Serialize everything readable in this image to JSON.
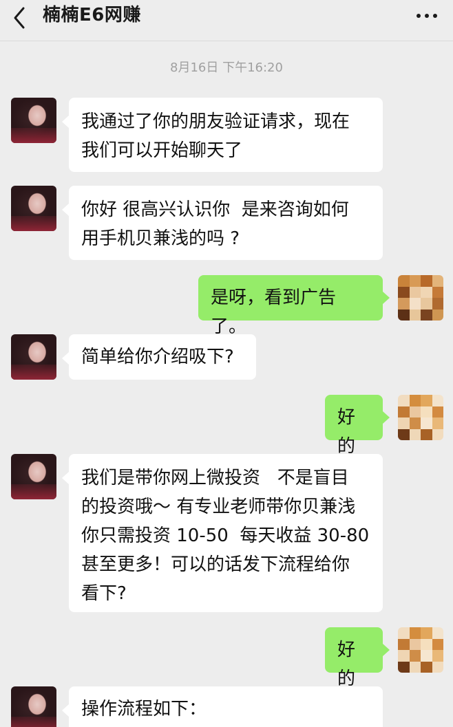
{
  "header": {
    "title": "楠楠E6网赚",
    "back_icon": "chevron-left-icon",
    "more_icon": "more-dots-icon"
  },
  "timestamp": "8月16日 下午16:20",
  "messages": [
    {
      "side": "left",
      "text": "我通过了你的朋友验证请求，现在\n我们可以开始聊天了"
    },
    {
      "side": "left",
      "text": "你好 很高兴认识你  是来咨询如何\n用手机贝兼浅的吗 ?"
    },
    {
      "side": "right",
      "text": "是呀，看到广告了。"
    },
    {
      "side": "left",
      "text": "简单给你介绍吸下?"
    },
    {
      "side": "right",
      "text": "好的"
    },
    {
      "side": "left",
      "text": "我们是带你网上微投资   不是盲目\n的投资哦～ 有专业老师带你贝兼浅\n你只需投资 10-50  每天收益 30-80\n甚至更多！可以的话发下流程给你\n看下?"
    },
    {
      "side": "right",
      "text": "好的"
    },
    {
      "side": "left",
      "text": "操作流程如下："
    }
  ],
  "colors": {
    "background": "#ededed",
    "incoming_bubble": "#ffffff",
    "outgoing_bubble": "#95ec69",
    "timestamp_text": "#a0a0a0"
  }
}
